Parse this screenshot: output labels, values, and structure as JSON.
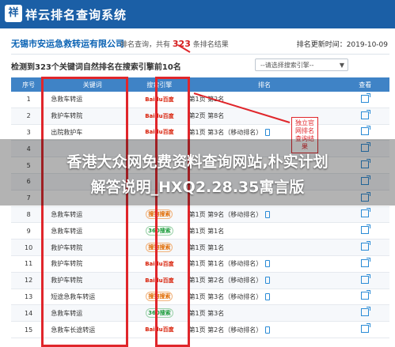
{
  "app": {
    "logo_char": "祥",
    "title": "祥云排名查询系统"
  },
  "company_bar": {
    "company": "无锡市安运急救转运有限公司",
    "prefix": "排名查询，共有",
    "count": "323",
    "suffix": "条排名结果",
    "date_label": "排名更新时间：2019-10-09"
  },
  "summary": "检测到323个关键词自然排名在搜索引擎前10名",
  "engine_select": {
    "placeholder": "--请选择搜索引擎--"
  },
  "table": {
    "headers": [
      "序号",
      "关键词",
      "搜索引擎",
      "排名",
      "查看"
    ],
    "rows": [
      {
        "no": "1",
        "keyword": "急救车转运",
        "engine": "Baidu百度",
        "engine_type": "baidu",
        "rank": "第1页 第2名",
        "mobile": false
      },
      {
        "no": "2",
        "keyword": "救护车转院",
        "engine": "Baidu百度",
        "engine_type": "baidu",
        "rank": "第2页 第8名",
        "mobile": false
      },
      {
        "no": "3",
        "keyword": "出院救护车",
        "engine": "Baidu百度",
        "engine_type": "baidu",
        "rank": "第1页 第3名（移动排名）",
        "mobile": true
      },
      {
        "no": "4",
        "keyword": "",
        "engine": "",
        "engine_type": "",
        "rank": "",
        "mobile": false
      },
      {
        "no": "5",
        "keyword": "",
        "engine": "",
        "engine_type": "",
        "rank": "",
        "mobile": false
      },
      {
        "no": "6",
        "keyword": "",
        "engine": "",
        "engine_type": "",
        "rank": "",
        "mobile": false
      },
      {
        "no": "7",
        "keyword": "",
        "engine": "",
        "engine_type": "",
        "rank": "",
        "mobile": false
      },
      {
        "no": "8",
        "keyword": "急救车转运",
        "engine": "搜狗搜索",
        "engine_type": "sogou",
        "rank": "第1页 第9名（移动排名）",
        "mobile": true
      },
      {
        "no": "9",
        "keyword": "急救车转运",
        "engine": "360搜索",
        "engine_type": "so360",
        "rank": "第1页 第1名",
        "mobile": false
      },
      {
        "no": "10",
        "keyword": "救护车转院",
        "engine": "搜狗搜索",
        "engine_type": "sogou",
        "rank": "第1页 第1名",
        "mobile": false
      },
      {
        "no": "11",
        "keyword": "救护车转院",
        "engine": "Baidu百度",
        "engine_type": "baidu",
        "rank": "第1页 第1名（移动排名）",
        "mobile": true
      },
      {
        "no": "12",
        "keyword": "救护车转院",
        "engine": "Baidu百度",
        "engine_type": "baidu",
        "rank": "第1页 第2名（移动排名）",
        "mobile": true
      },
      {
        "no": "13",
        "keyword": "短途急救车转运",
        "engine": "搜狗搜索",
        "engine_type": "sogou",
        "rank": "第1页 第3名（移动排名）",
        "mobile": true
      },
      {
        "no": "14",
        "keyword": "急救车转运",
        "engine": "360搜索",
        "engine_type": "so360",
        "rank": "第1页 第3名",
        "mobile": false
      },
      {
        "no": "15",
        "keyword": "急救车长途转运",
        "engine": "Baidu百度",
        "engine_type": "baidu",
        "rank": "第1页 第2名（移动排名）",
        "mobile": true
      }
    ]
  },
  "callout": "独立官网排名查询结果",
  "banner": {
    "line1": "香港大众网免费资料查询网站,朴实计划",
    "line2": "解答说明_HXQ2.28.35寓言版"
  },
  "colors": {
    "header": "#1b5fa6",
    "table_header": "#3f83c6",
    "highlight": "#e0262b"
  }
}
